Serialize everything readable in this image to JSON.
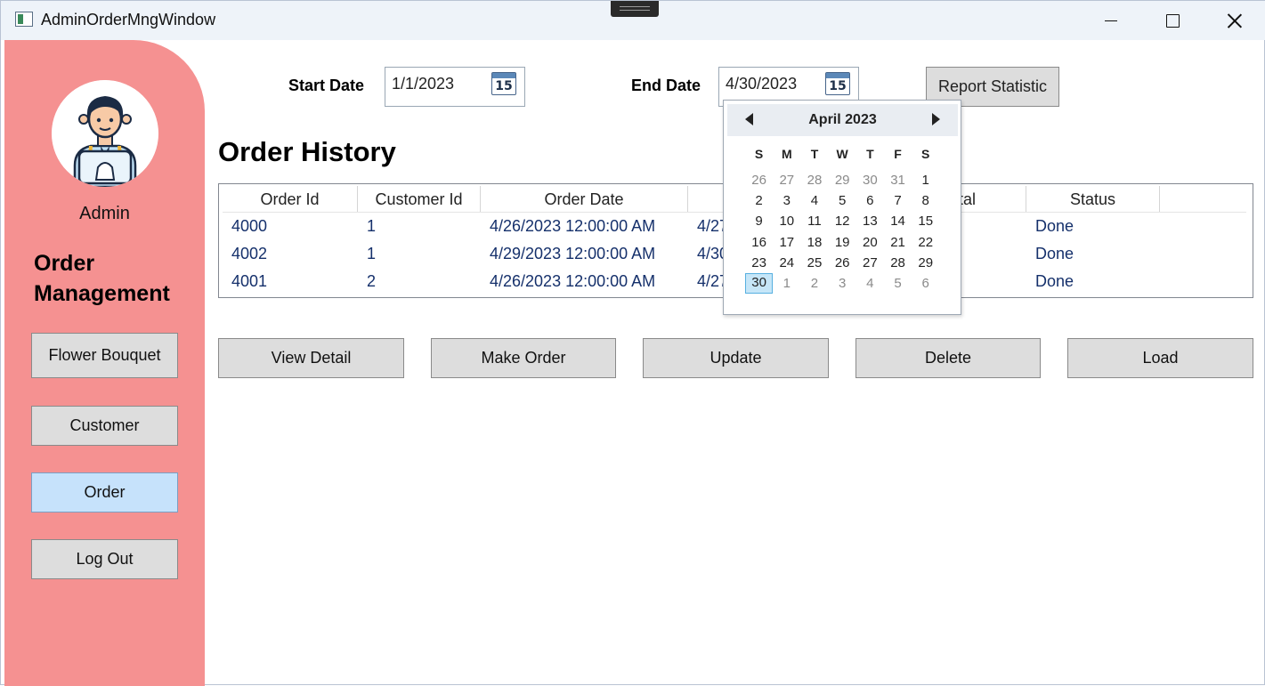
{
  "window": {
    "title": "AdminOrderMngWindow"
  },
  "sidebar": {
    "admin_name": "Admin",
    "section_title": "Order Management",
    "nav": {
      "flower_bouquet": "Flower Bouquet",
      "customer": "Customer",
      "order": "Order",
      "logout": "Log Out"
    },
    "active_item": "Order"
  },
  "filters": {
    "start_label": "Start Date",
    "start_value": "1/1/2023",
    "end_label": "End Date",
    "end_value": "4/30/2023",
    "calendar_icon_number": "15",
    "report_button": "Report Statistic"
  },
  "order_history": {
    "heading": "Order History",
    "columns": [
      "Order Id",
      "Customer Id",
      "Order Date",
      "",
      "tal",
      "Status"
    ],
    "rows": [
      [
        "4000",
        "1",
        "4/26/2023 12:00:00 AM",
        "4/27",
        "",
        "Done"
      ],
      [
        "4002",
        "1",
        "4/29/2023 12:00:00 AM",
        "4/30",
        "",
        "Done"
      ],
      [
        "4001",
        "2",
        "4/26/2023 12:00:00 AM",
        "4/27",
        "",
        "Done"
      ]
    ]
  },
  "actions": {
    "view_detail": "View Detail",
    "make_order": "Make Order",
    "update": "Update",
    "delete": "Delete",
    "load": "Load"
  },
  "calendar_popup": {
    "month_label": "April 2023",
    "days_of_week": [
      "S",
      "M",
      "T",
      "W",
      "T",
      "F",
      "S"
    ],
    "days": [
      {
        "d": "26",
        "muted": true
      },
      {
        "d": "27",
        "muted": true
      },
      {
        "d": "28",
        "muted": true
      },
      {
        "d": "29",
        "muted": true
      },
      {
        "d": "30",
        "muted": true
      },
      {
        "d": "31",
        "muted": true
      },
      {
        "d": "1"
      },
      {
        "d": "2"
      },
      {
        "d": "3"
      },
      {
        "d": "4"
      },
      {
        "d": "5"
      },
      {
        "d": "6"
      },
      {
        "d": "7"
      },
      {
        "d": "8"
      },
      {
        "d": "9"
      },
      {
        "d": "10"
      },
      {
        "d": "11"
      },
      {
        "d": "12"
      },
      {
        "d": "13"
      },
      {
        "d": "14"
      },
      {
        "d": "15"
      },
      {
        "d": "16"
      },
      {
        "d": "17"
      },
      {
        "d": "18"
      },
      {
        "d": "19"
      },
      {
        "d": "20"
      },
      {
        "d": "21"
      },
      {
        "d": "22"
      },
      {
        "d": "23"
      },
      {
        "d": "24"
      },
      {
        "d": "25"
      },
      {
        "d": "26"
      },
      {
        "d": "27"
      },
      {
        "d": "28"
      },
      {
        "d": "29"
      },
      {
        "d": "30",
        "selected": true
      },
      {
        "d": "1",
        "muted": true
      },
      {
        "d": "2",
        "muted": true
      },
      {
        "d": "3",
        "muted": true
      },
      {
        "d": "4",
        "muted": true
      },
      {
        "d": "5",
        "muted": true
      },
      {
        "d": "6",
        "muted": true
      }
    ]
  },
  "colors": {
    "sidebar_bg": "#f59191",
    "active_nav_bg": "#c6e2fb",
    "button_bg": "#dddddd",
    "grid_text": "#15306b",
    "calendar_selected": "#c6e6f8"
  }
}
